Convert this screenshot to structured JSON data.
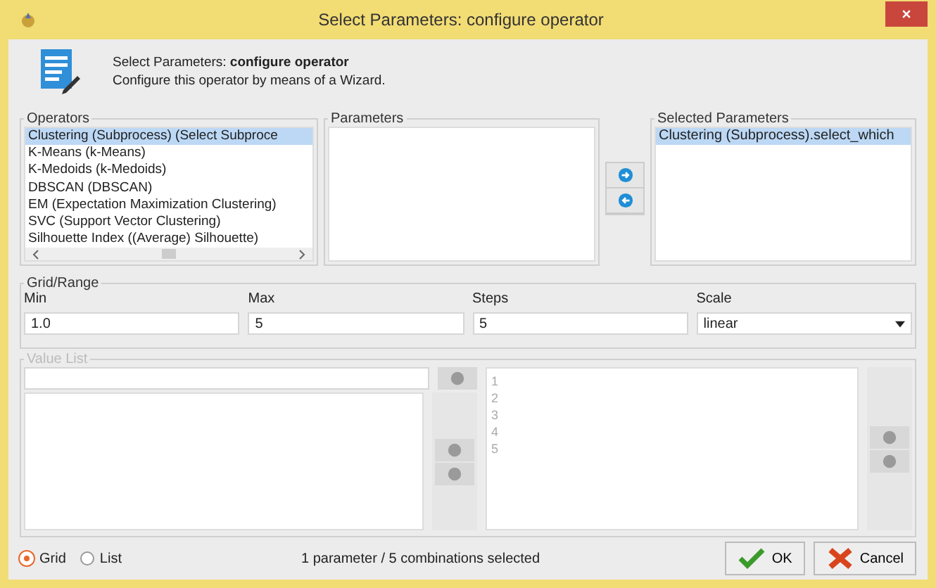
{
  "window": {
    "title": "Select Parameters: configure operator"
  },
  "header": {
    "title": "Select Parameters: **configure operator**",
    "description": "Configure this operator by means of a Wizard."
  },
  "operators": {
    "label": "Operators",
    "items": [
      {
        "label": "Clustering (Subprocess) (Select Subproce",
        "selected": true
      },
      {
        "label": "K-Means (k-Means)",
        "selected": false
      },
      {
        "label": "K-Medoids (k-Medoids)",
        "selected": false
      },
      {
        "label": "DBSCAN (DBSCAN)",
        "selected": false
      },
      {
        "label": "EM (Expectation Maximization Clustering)",
        "selected": false
      },
      {
        "label": "SVC (Support Vector Clustering)",
        "selected": false
      },
      {
        "label": "Silhouette Index ((Average) Silhouette)",
        "selected": false
      }
    ]
  },
  "parameters": {
    "label": "Parameters"
  },
  "selected_parameters": {
    "label": "Selected Parameters",
    "items": [
      {
        "label": "Clustering (Subprocess).select_which",
        "selected": true
      }
    ]
  },
  "grid_range": {
    "label": "Grid/Range",
    "fields": [
      {
        "label": "Min",
        "value": "1.0",
        "kind": "text"
      },
      {
        "label": "Max",
        "value": "5",
        "kind": "text"
      },
      {
        "label": "Steps",
        "value": "5",
        "kind": "text"
      },
      {
        "label": "Scale",
        "value": "linear",
        "kind": "dropdown"
      }
    ]
  },
  "value_list": {
    "label": "Value List",
    "disabled": true,
    "values": [
      "1",
      "2",
      "3",
      "4",
      "5"
    ]
  },
  "mode": [
    {
      "label": "Grid",
      "selected": true
    },
    {
      "label": "List",
      "selected": false
    }
  ],
  "status": "1 parameter / 5 combinations selected",
  "buttons": [
    {
      "label": "OK",
      "kind": "ok"
    },
    {
      "label": "Cancel",
      "kind": "cancel"
    }
  ]
}
